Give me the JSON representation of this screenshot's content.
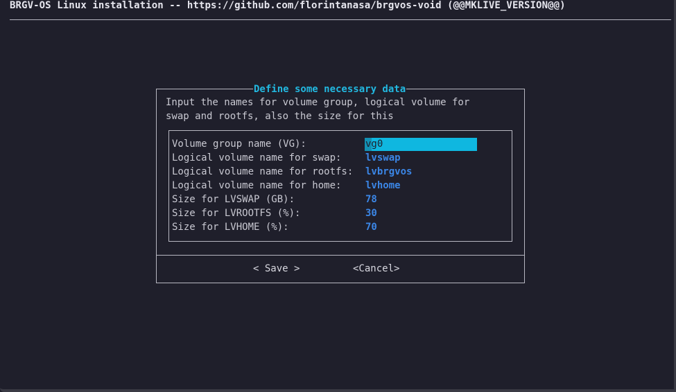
{
  "terminal": {
    "title": "BRGV-OS Linux installation -- https://github.com/florintanasa/brgvos-void (@@MKLIVE_VERSION@@)"
  },
  "dialog": {
    "title": "Define some necessary data",
    "description_line1": "Input the names for volume group, logical volume for",
    "description_line2": "swap and rootfs, also the size for this",
    "fields": [
      {
        "label": "Volume group name (VG):",
        "value": "vg0"
      },
      {
        "label": "Logical volume name for swap:",
        "value": "lvswap"
      },
      {
        "label": "Logical volume name for rootfs:",
        "value": "lvbrgvos"
      },
      {
        "label": "Logical volume name for home:",
        "value": "lvhome"
      },
      {
        "label": "Size for LVSWAP (GB):",
        "value": "78"
      },
      {
        "label": "Size for LVROOTFS (%):",
        "value": "30"
      },
      {
        "label": "Size for LVHOME (%):",
        "value": "70"
      }
    ],
    "buttons": {
      "save": "< Save >",
      "cancel": "<Cancel>"
    }
  },
  "colors": {
    "accent": "#22b8e0",
    "value": "#3b86e6",
    "active_field_bg": "#0fb7e0",
    "background": "#1f1f2b"
  }
}
